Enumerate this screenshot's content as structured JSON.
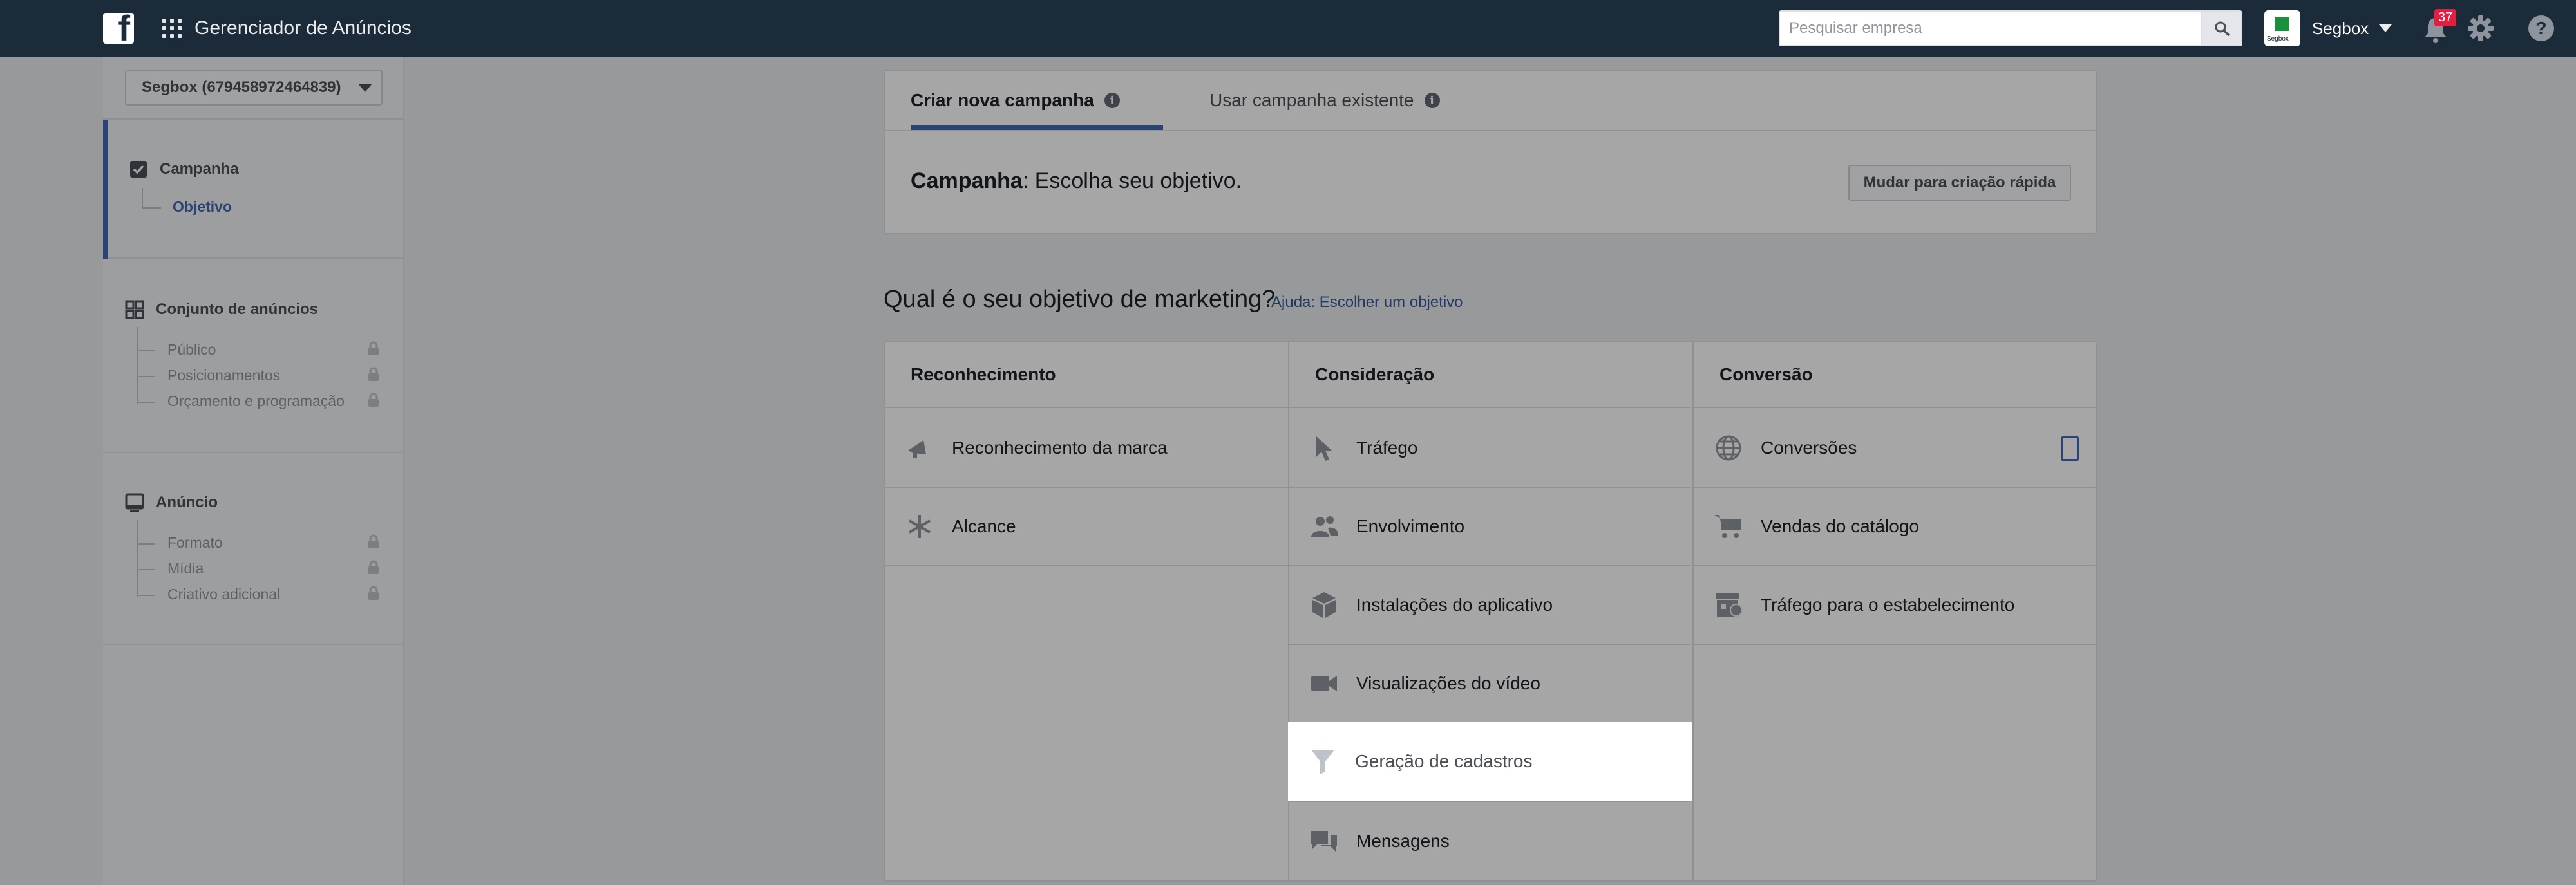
{
  "app": {
    "title": "Gerenciador de Anúncios",
    "search_placeholder": "Pesquisar empresa",
    "account_name": "Segbox",
    "account_logo_text": "Segbox",
    "notifications_count": "37",
    "help_label": "?"
  },
  "sidebar": {
    "account_select": "Segbox (679458972464839)",
    "campaign": {
      "label": "Campanha",
      "sub": "Objetivo"
    },
    "ad_set": {
      "label": "Conjunto de anúncios",
      "subs": [
        "Público",
        "Posicionamentos",
        "Orçamento e programação"
      ]
    },
    "ad": {
      "label": "Anúncio",
      "subs": [
        "Formato",
        "Mídia",
        "Criativo adicional"
      ]
    }
  },
  "tabs": {
    "new": "Criar nova campanha",
    "existing": "Usar campanha existente"
  },
  "campaign_line": {
    "bold": "Campanha",
    "rest": ": Escolha seu objetivo."
  },
  "quick_create": "Mudar para criação rápida",
  "question": "Qual é o seu objetivo de marketing?",
  "help_link": "Ajuda: Escolher um objetivo",
  "columns": [
    {
      "title": "Reconhecimento",
      "items": [
        "Reconhecimento da marca",
        "Alcance"
      ]
    },
    {
      "title": "Consideração",
      "items": [
        "Tráfego",
        "Envolvimento",
        "Instalações do aplicativo",
        "Visualizações do vídeo",
        "Geração de cadastros",
        "Mensagens"
      ]
    },
    {
      "title": "Conversão",
      "items": [
        "Conversões",
        "Vendas do catálogo",
        "Tráfego para o estabelecimento"
      ]
    }
  ],
  "colors": {
    "topbar": "#1c2b39",
    "accent": "#4267b2",
    "link": "#365899",
    "badge": "#e41e3f"
  }
}
